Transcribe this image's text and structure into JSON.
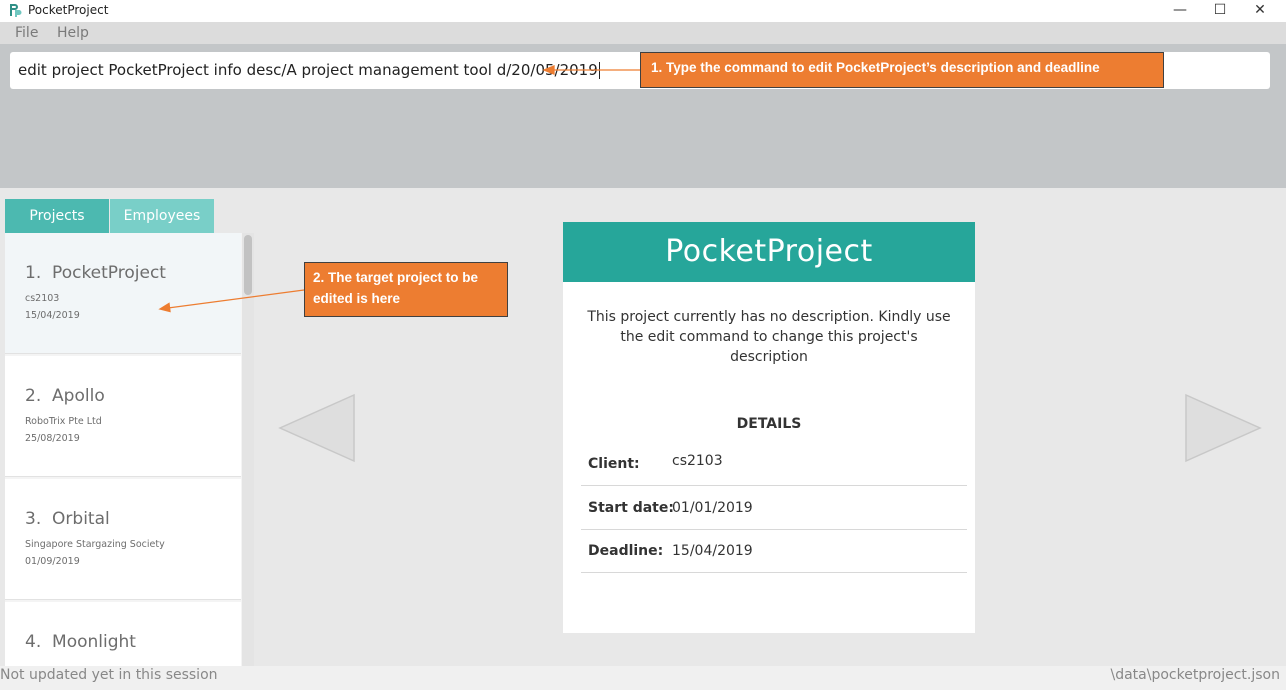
{
  "window": {
    "title": "PocketProject",
    "minimize_glyph": "—",
    "maximize_glyph": "☐",
    "close_glyph": "✕"
  },
  "menu": {
    "file": "File",
    "help": "Help"
  },
  "command": {
    "value": "edit project PocketProject info desc/A project management tool d/20/05/2019"
  },
  "callouts": {
    "step1": "1. Type the command to edit PocketProject’s description and deadline",
    "step2": "2. The target project to be edited is here"
  },
  "tabs": [
    {
      "label": "Projects",
      "active": true
    },
    {
      "label": "Employees",
      "active": false
    }
  ],
  "projects": [
    {
      "index": "1.",
      "name": "PocketProject",
      "client": "cs2103",
      "date": "15/04/2019"
    },
    {
      "index": "2.",
      "name": "Apollo",
      "client": "RoboTrix Pte Ltd",
      "date": "25/08/2019"
    },
    {
      "index": "3.",
      "name": "Orbital",
      "client": "Singapore Stargazing Society",
      "date": "01/09/2019"
    },
    {
      "index": "4.",
      "name": "Moonlight",
      "client": "",
      "date": ""
    }
  ],
  "card": {
    "title": "PocketProject",
    "description": "This project currently has no description. Kindly use the edit command to change this project's description",
    "details_heading": "DETAILS",
    "client_label": "Client:",
    "client_value": "cs2103",
    "start_label": "Start date:",
    "start_value": "01/01/2019",
    "deadline_label": "Deadline:",
    "deadline_value": "15/04/2019"
  },
  "status": {
    "left": "Not updated yet in this session",
    "right": "\\data\\pocketproject.json"
  },
  "colors": {
    "accent": "#26a69a",
    "callout": "#ed7d31"
  }
}
